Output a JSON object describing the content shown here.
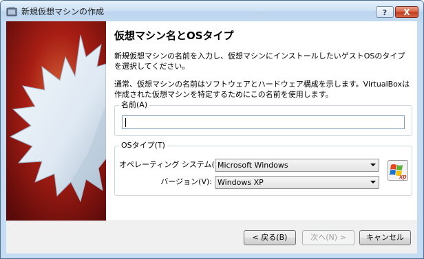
{
  "window": {
    "title": "新規仮想マシンの作成",
    "help_label": "?",
    "close_label": "X"
  },
  "page": {
    "heading": "仮想マシン名とOSタイプ",
    "intro": "新規仮想マシンの名前を入力し、仮想マシンにインストールしたいゲストOSのタイプを選択してください。",
    "note": "通常、仮想マシンの名前はソフトウェアとハードウェア構成を示します。VirtualBoxは作成された仮想マシンを特定するためにこの名前を使用します。"
  },
  "name_group": {
    "label": "名前(A)",
    "value": ""
  },
  "os_group": {
    "label": "OSタイプ(T)",
    "os_label": "オペレーティング システム(S):",
    "os_value": "Microsoft Windows",
    "version_label": "バージョン(V):",
    "version_value": "Windows XP",
    "logo_text": "xp"
  },
  "buttons": {
    "back": "< 戻る(B)",
    "next": "次へ(N) >",
    "cancel": "キャンセル"
  },
  "colors": {
    "sidebar_dark": "#5a0a0a",
    "sidebar_mid": "#a81e14",
    "sidebar_light": "#d86a3a",
    "starburst_fill": "#dfe9f3",
    "starburst_edge": "#9db3c7",
    "titlebar": "#c3daf1"
  }
}
